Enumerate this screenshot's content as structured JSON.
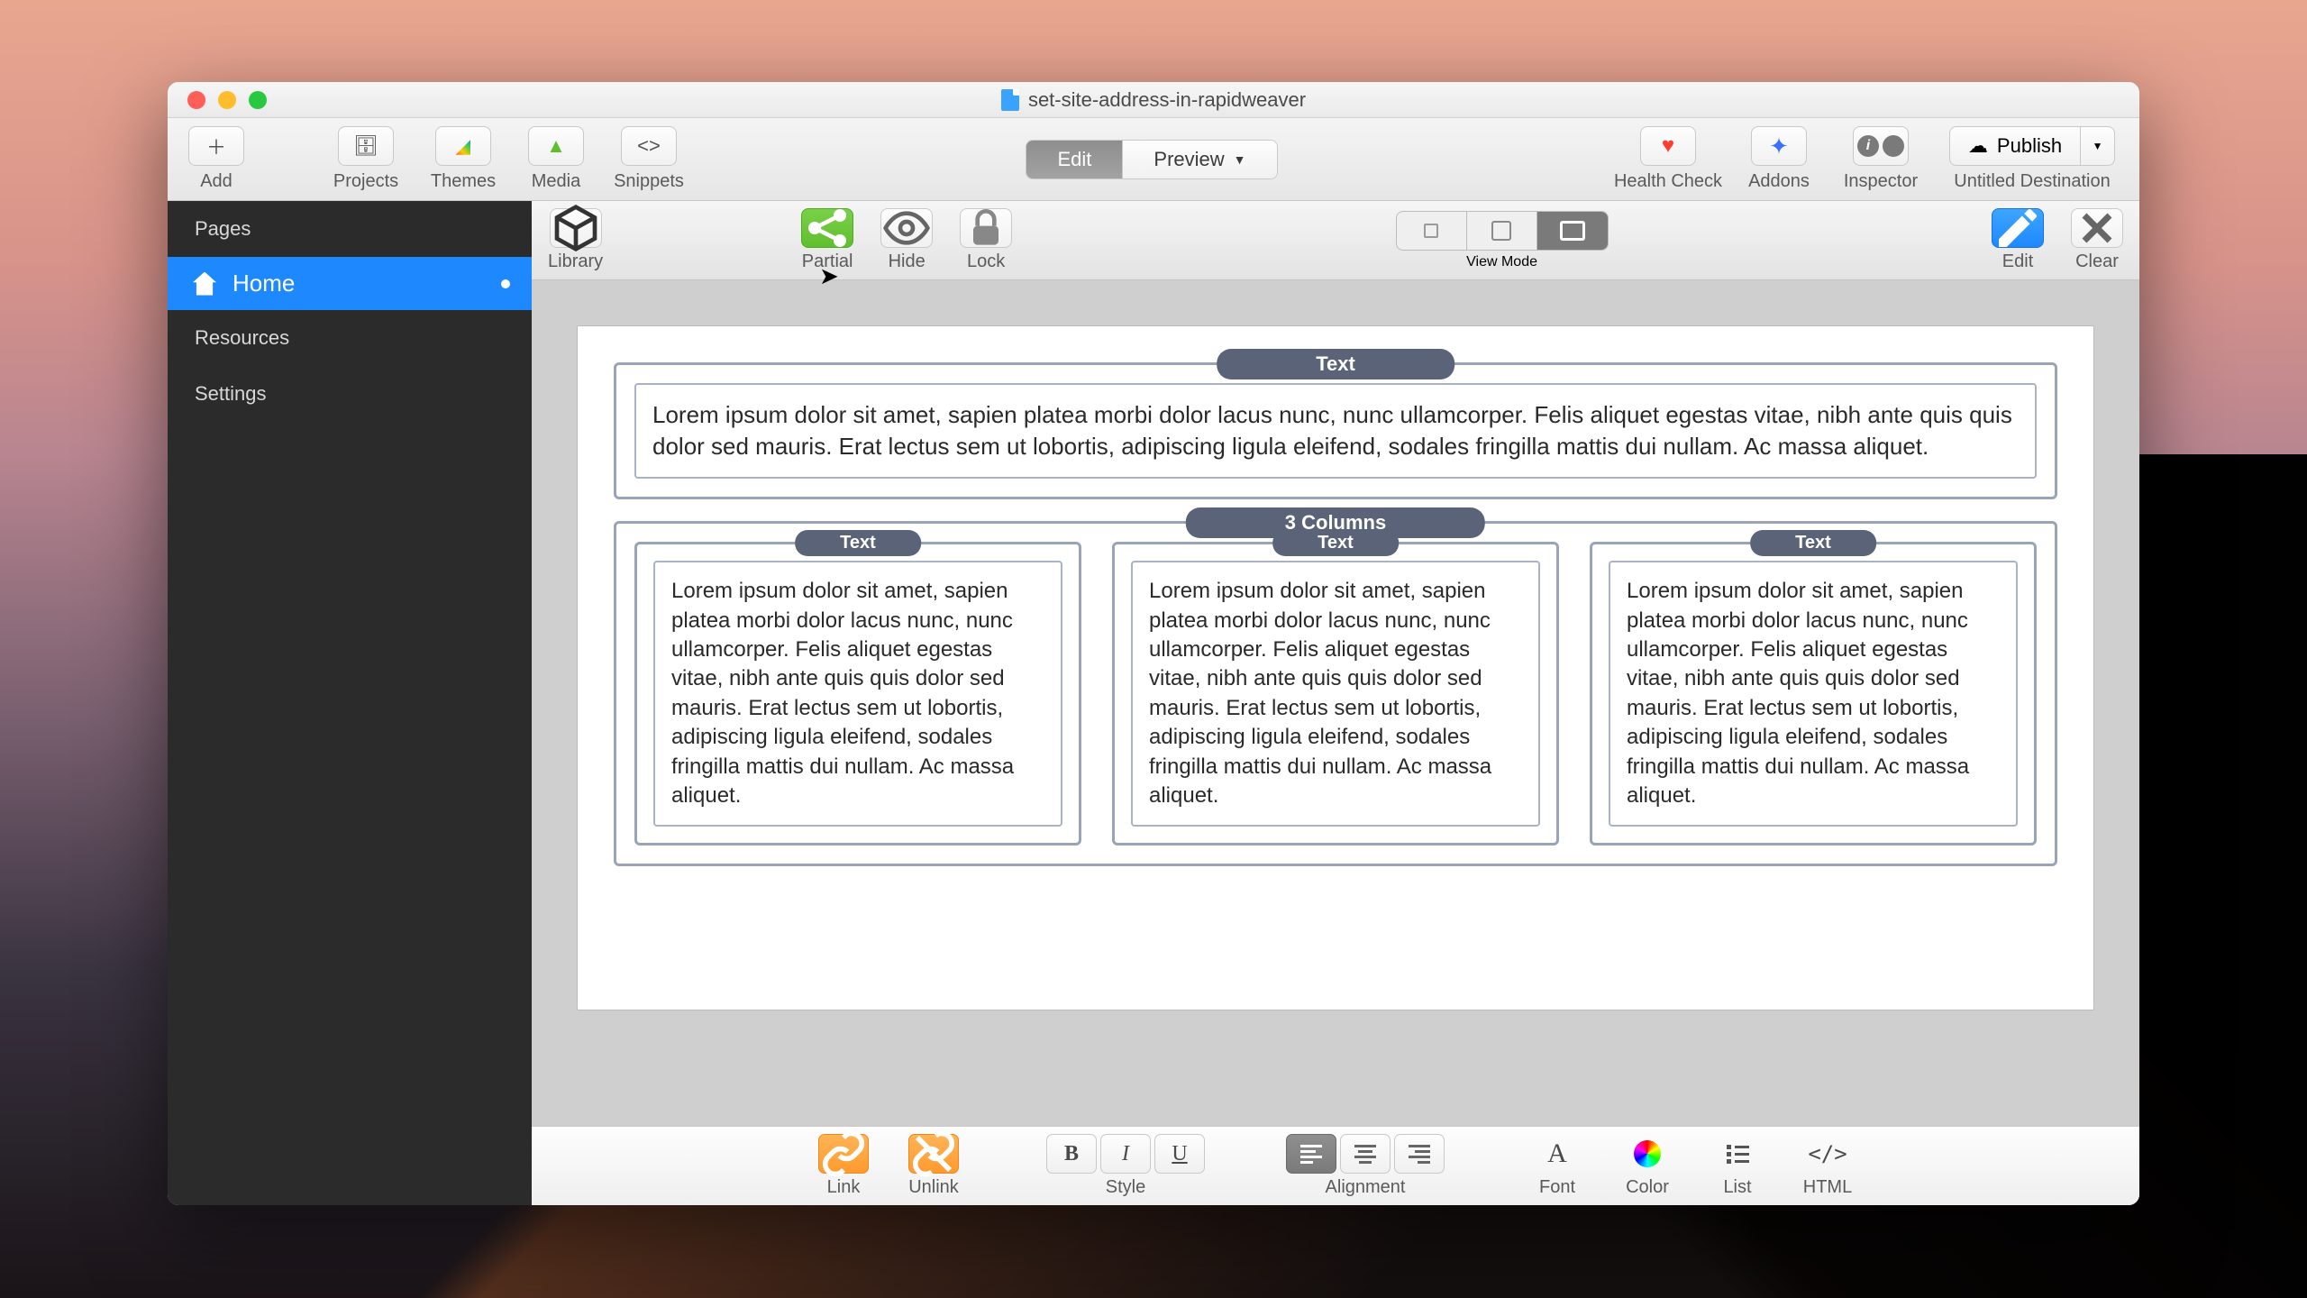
{
  "window_title": "set-site-address-in-rapidweaver",
  "toolbar": {
    "add": "Add",
    "projects": "Projects",
    "themes": "Themes",
    "media": "Media",
    "snippets": "Snippets",
    "edit": "Edit",
    "preview": "Preview",
    "health_check": "Health Check",
    "addons": "Addons",
    "inspector": "Inspector",
    "publish": "Publish",
    "destination": "Untitled Destination"
  },
  "sidebar": {
    "pages": "Pages",
    "home": "Home",
    "resources": "Resources",
    "settings": "Settings"
  },
  "stackbar": {
    "library": "Library",
    "partial": "Partial",
    "hide": "Hide",
    "lock": "Lock",
    "view_mode": "View Mode",
    "edit": "Edit",
    "clear": "Clear"
  },
  "canvas": {
    "text_label": "Text",
    "columns_label": "3 Columns",
    "lorem": "Lorem ipsum dolor sit amet, sapien platea morbi dolor lacus nunc, nunc ullamcorper. Felis aliquet egestas vitae, nibh ante quis quis dolor sed mauris. Erat lectus sem ut lobortis, adipiscing ligula eleifend, sodales fringilla mattis dui nullam. Ac massa aliquet."
  },
  "bottombar": {
    "link": "Link",
    "unlink": "Unlink",
    "style": "Style",
    "alignment": "Alignment",
    "font": "Font",
    "color": "Color",
    "list": "List",
    "html": "HTML"
  }
}
